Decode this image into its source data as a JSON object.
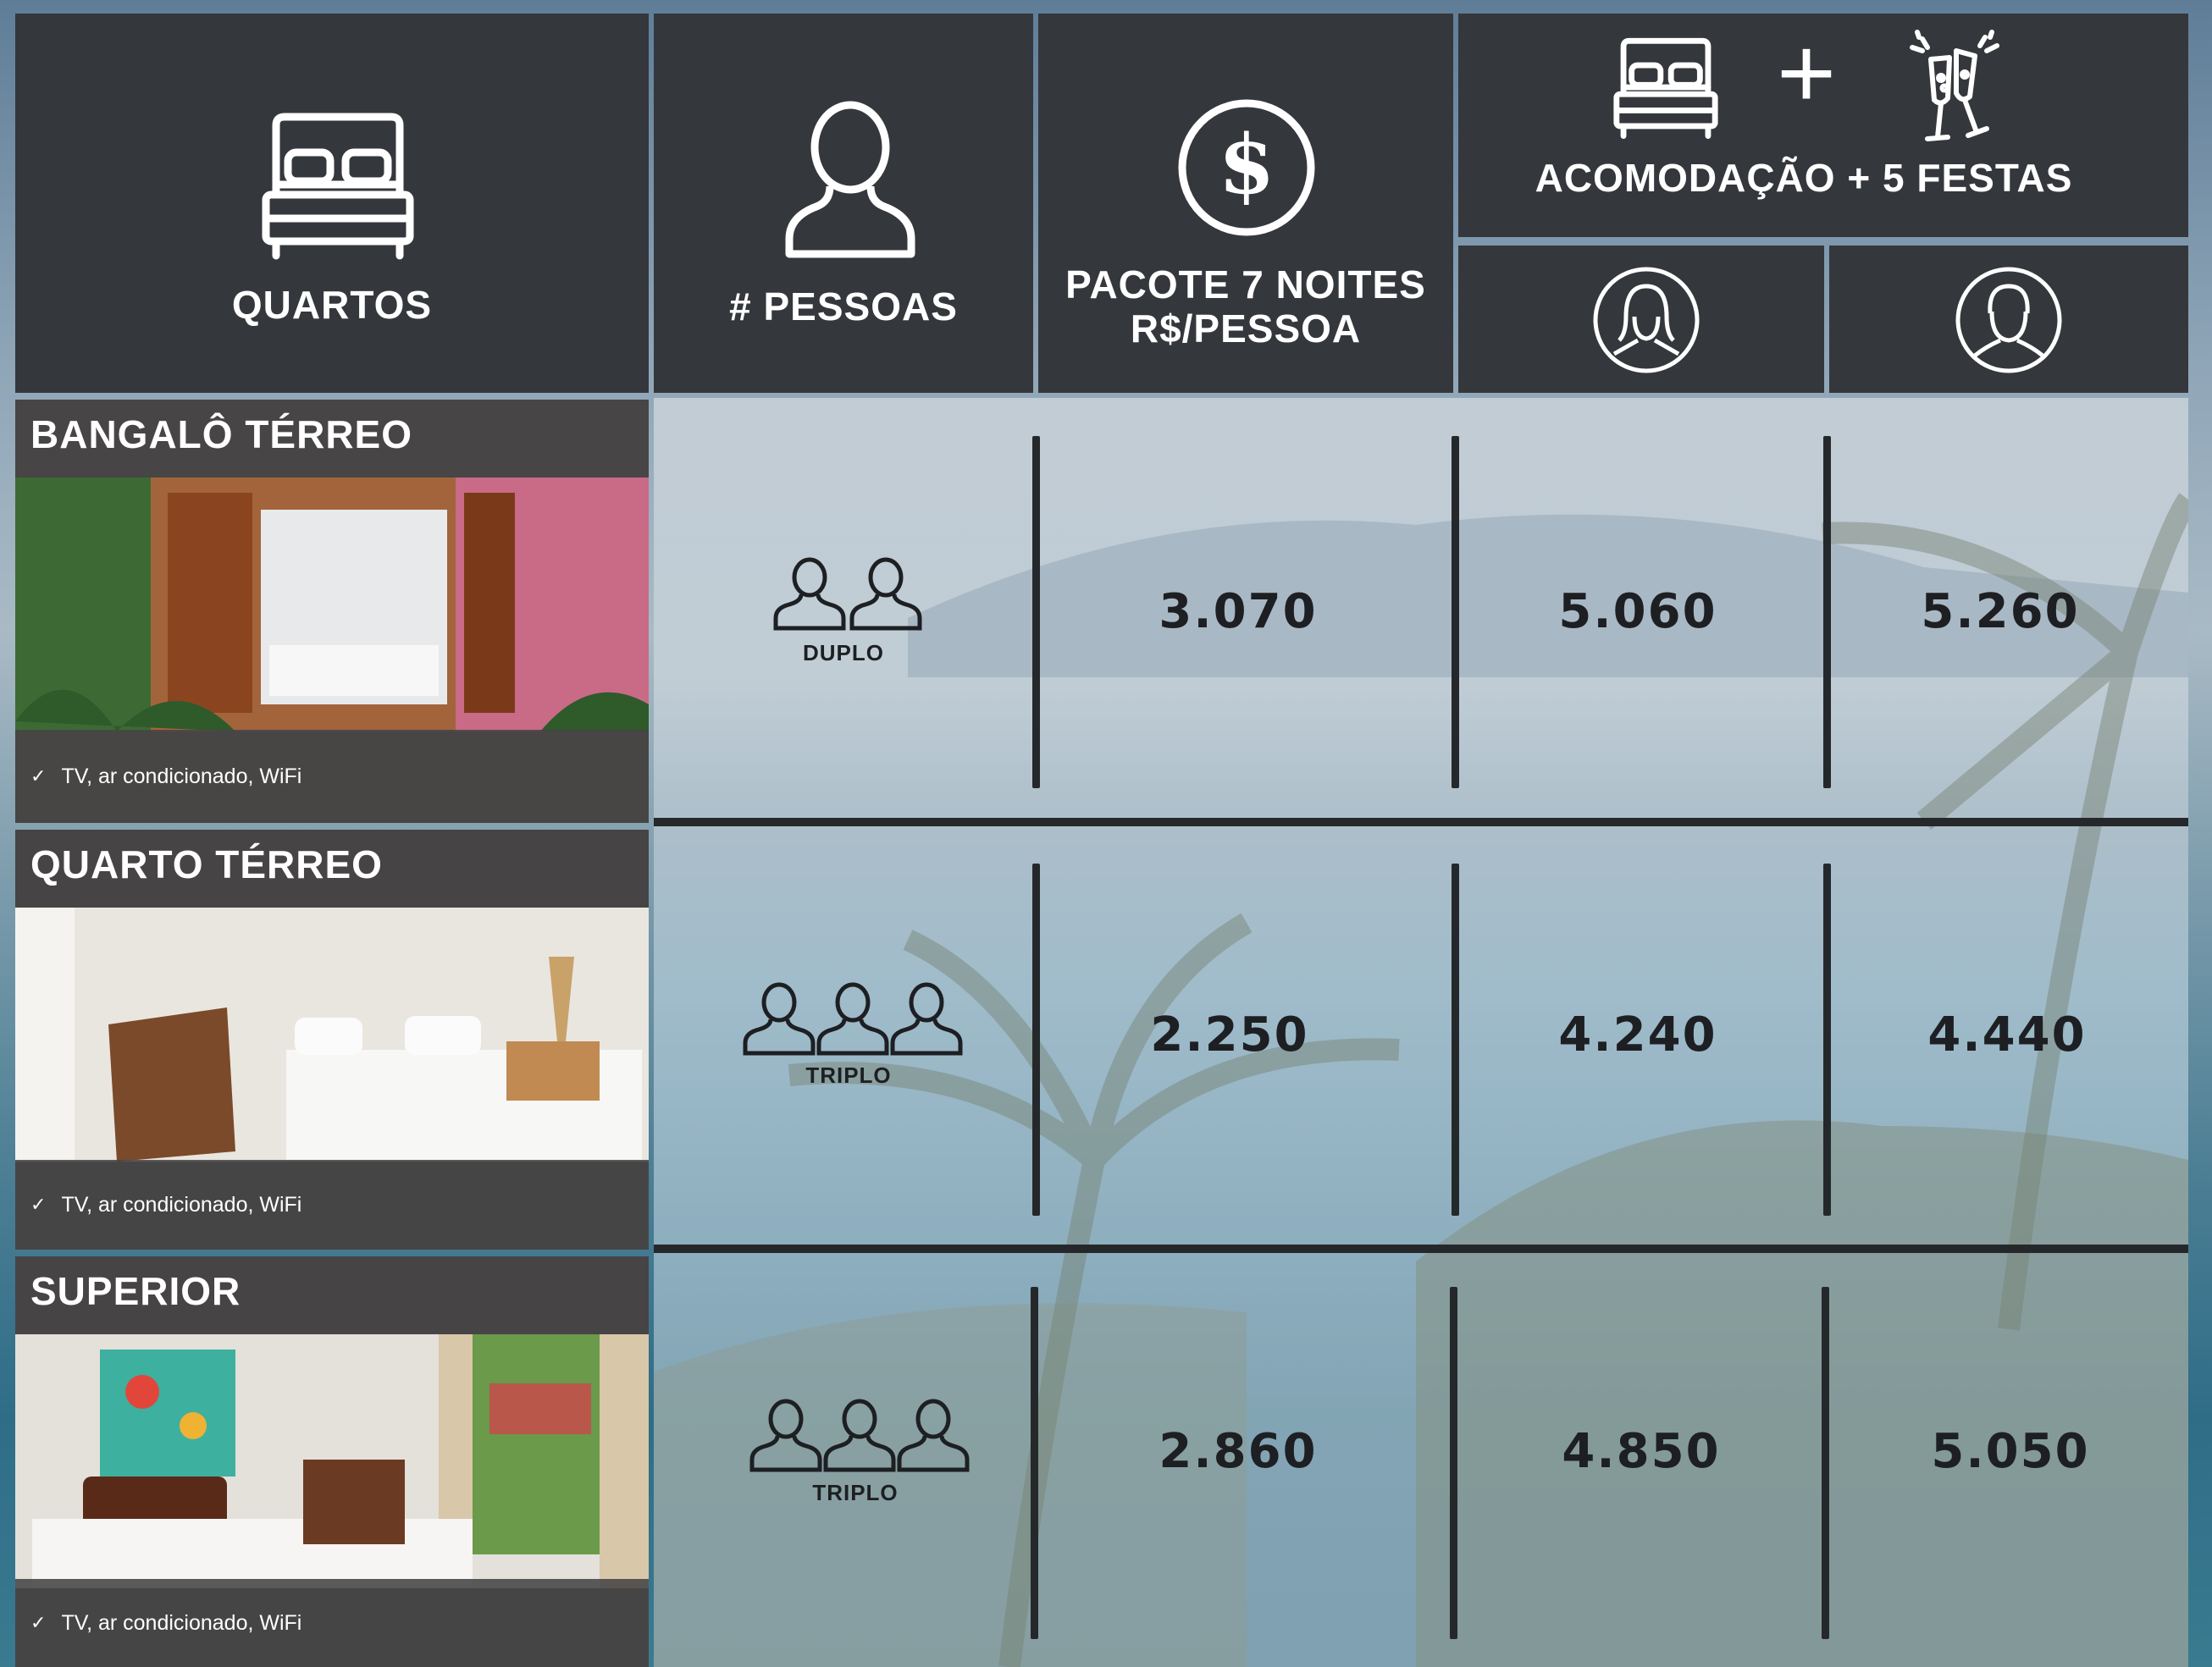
{
  "header": {
    "quartos": "QUARTOS",
    "pessoas": "# PESSOAS",
    "pacote_line1": "PACOTE 7 NOITES",
    "pacote_line2": "R$/PESSOA",
    "combo": "ACOMODAÇÃO + 5 FESTAS",
    "plus": "+"
  },
  "rooms": [
    {
      "name": "BANGALÔ TÉRREO",
      "amenities": "TV, ar condicionado, WiFi",
      "occupancy": "DUPLO",
      "people_count": 2,
      "prices": [
        "3.070",
        "5.060",
        "5.260"
      ]
    },
    {
      "name": "QUARTO TÉRREO",
      "amenities": "TV, ar condicionado, WiFi",
      "occupancy": "TRIPLO",
      "people_count": 3,
      "prices": [
        "2.250",
        "4.240",
        "4.440"
      ]
    },
    {
      "name": "SUPERIOR",
      "amenities": "TV, ar condicionado, WiFi",
      "occupancy": "TRIPLO",
      "people_count": 3,
      "prices": [
        "2.860",
        "4.850",
        "5.050"
      ]
    }
  ],
  "check": "✓",
  "icons": [
    "bed-icon",
    "person-icon",
    "dollar-icon",
    "champagne-icon",
    "female-avatar-icon",
    "male-avatar-icon"
  ],
  "colors": {
    "header_bg": "#34373c",
    "text_dark": "#1d1f22",
    "divider": "#25282b"
  }
}
